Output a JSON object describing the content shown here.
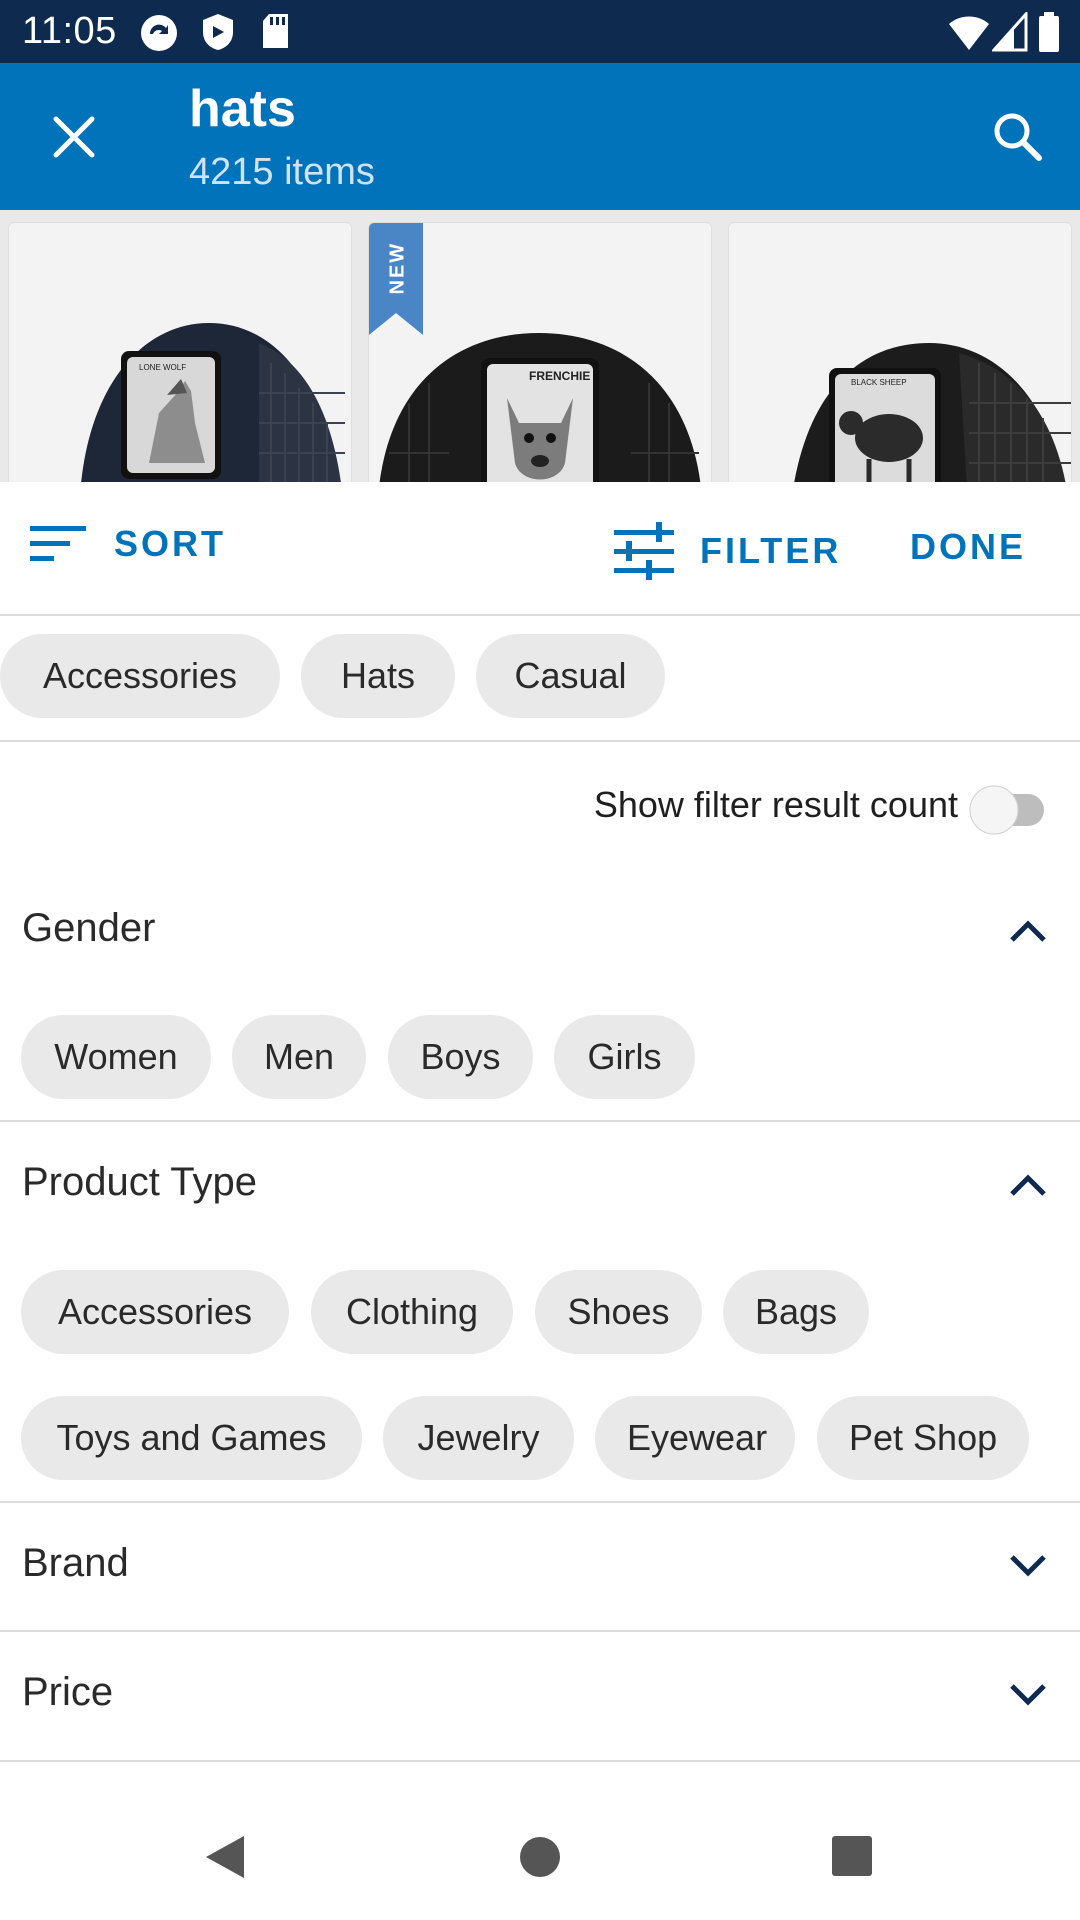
{
  "status_bar": {
    "time": "11:05"
  },
  "app_bar": {
    "title": "hats",
    "subtitle": "4215 items"
  },
  "products": [
    {
      "patch_text": "LONE WOLF"
    },
    {
      "patch_text": "FRENCHIE",
      "badge": "NEW"
    },
    {
      "patch_text": "BLACK SHEEP"
    }
  ],
  "toolbar": {
    "sort_label": "SORT",
    "filter_label": "FILTER",
    "done_label": "DONE"
  },
  "selected_filters": [
    "Accessories",
    "Hats",
    "Casual"
  ],
  "filter_count_toggle": {
    "label": "Show filter result count",
    "on": false
  },
  "sections": {
    "gender": {
      "title": "Gender",
      "expanded": true,
      "options": [
        "Women",
        "Men",
        "Boys",
        "Girls"
      ]
    },
    "product_type": {
      "title": "Product Type",
      "expanded": true,
      "options": [
        "Accessories",
        "Clothing",
        "Shoes",
        "Bags",
        "Toys and Games",
        "Jewelry",
        "Eyewear",
        "Pet Shop"
      ]
    },
    "brand": {
      "title": "Brand",
      "expanded": false
    },
    "price": {
      "title": "Price",
      "expanded": false
    }
  },
  "colors": {
    "status_bar": "#0e2a4e",
    "app_bar": "#0073bb",
    "accent": "#0073bb",
    "chip_bg": "#e9e9e9"
  }
}
